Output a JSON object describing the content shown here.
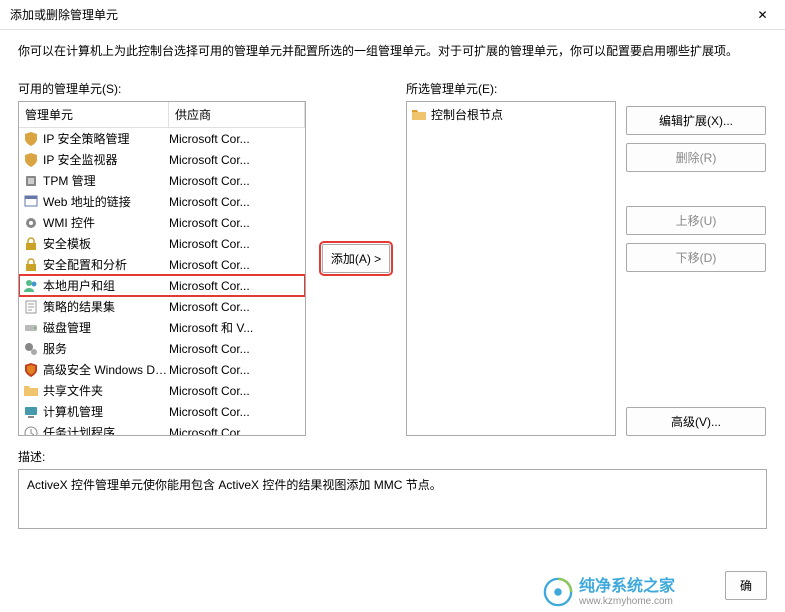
{
  "window": {
    "title": "添加或删除管理单元",
    "close": "✕"
  },
  "intro": "你可以在计算机上为此控制台选择可用的管理单元并配置所选的一组管理单元。对于可扩展的管理单元，你可以配置要启用哪些扩展项。",
  "available": {
    "label": "可用的管理单元(S):",
    "col_name": "管理单元",
    "col_vendor": "供应商",
    "items": [
      {
        "name": "IP 安全策略管理",
        "vendor": "Microsoft Cor...",
        "icon": "shield"
      },
      {
        "name": "IP 安全监视器",
        "vendor": "Microsoft Cor...",
        "icon": "shield"
      },
      {
        "name": "TPM 管理",
        "vendor": "Microsoft Cor...",
        "icon": "chip"
      },
      {
        "name": "Web 地址的链接",
        "vendor": "Microsoft Cor...",
        "icon": "link"
      },
      {
        "name": "WMI 控件",
        "vendor": "Microsoft Cor...",
        "icon": "gear"
      },
      {
        "name": "安全模板",
        "vendor": "Microsoft Cor...",
        "icon": "lock"
      },
      {
        "name": "安全配置和分析",
        "vendor": "Microsoft Cor...",
        "icon": "lock"
      },
      {
        "name": "本地用户和组",
        "vendor": "Microsoft Cor...",
        "icon": "users",
        "highlight": true
      },
      {
        "name": "策略的结果集",
        "vendor": "Microsoft Cor...",
        "icon": "report"
      },
      {
        "name": "磁盘管理",
        "vendor": "Microsoft 和 V...",
        "icon": "disk"
      },
      {
        "name": "服务",
        "vendor": "Microsoft Cor...",
        "icon": "gears"
      },
      {
        "name": "高级安全 Windows De...",
        "vendor": "Microsoft Cor...",
        "icon": "firewall"
      },
      {
        "name": "共享文件夹",
        "vendor": "Microsoft Cor...",
        "icon": "folder"
      },
      {
        "name": "计算机管理",
        "vendor": "Microsoft Cor...",
        "icon": "computer"
      },
      {
        "name": "任务计划程序",
        "vendor": "Microsoft Cor...",
        "icon": "clock"
      }
    ]
  },
  "selected": {
    "label": "所选管理单元(E):",
    "root": "控制台根节点"
  },
  "buttons": {
    "add": "添加(A) >",
    "edit_ext": "编辑扩展(X)...",
    "remove": "删除(R)",
    "move_up": "上移(U)",
    "move_down": "下移(D)",
    "advanced": "高级(V)...",
    "ok": "确"
  },
  "description": {
    "label": "描述:",
    "text": "ActiveX 控件管理单元使你能用包含 ActiveX 控件的结果视图添加 MMC 节点。"
  },
  "watermark": {
    "cn": "纯净系统之家",
    "url": "www.kzmyhome.com"
  }
}
